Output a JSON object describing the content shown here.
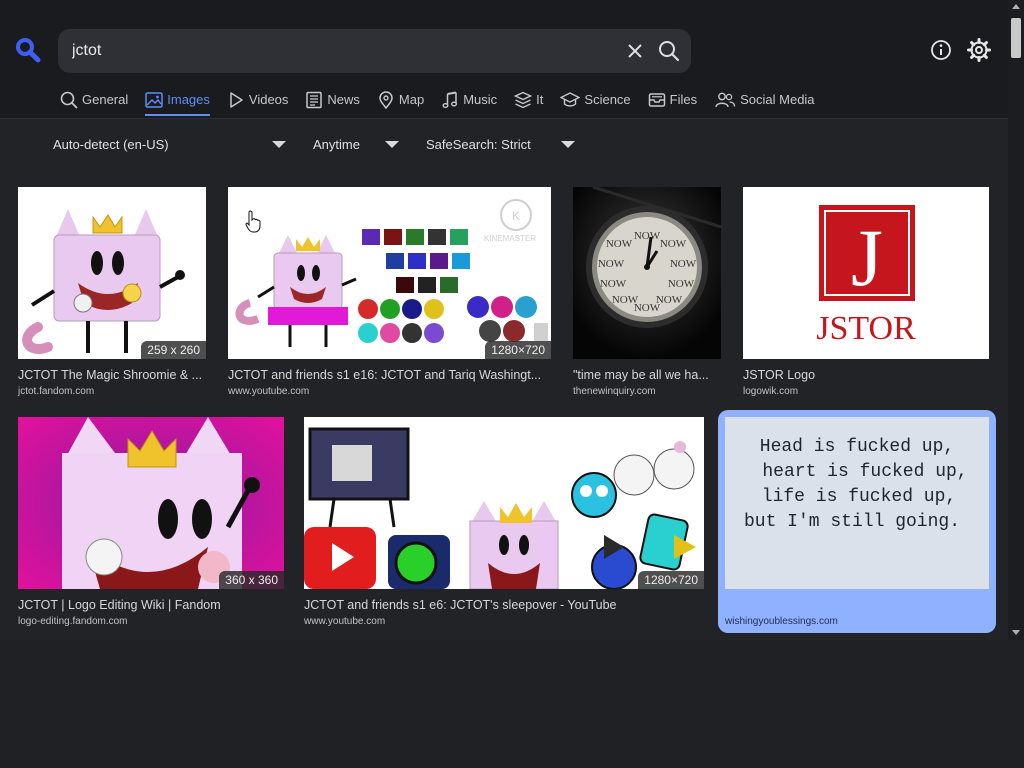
{
  "search": {
    "query": "jctot",
    "placeholder": ""
  },
  "tabs": [
    {
      "label": "General",
      "icon": "magnifier-icon",
      "active": false
    },
    {
      "label": "Images",
      "icon": "image-icon",
      "active": true
    },
    {
      "label": "Videos",
      "icon": "play-icon",
      "active": false
    },
    {
      "label": "News",
      "icon": "newspaper-icon",
      "active": false
    },
    {
      "label": "Map",
      "icon": "map-pin-icon",
      "active": false
    },
    {
      "label": "Music",
      "icon": "music-note-icon",
      "active": false
    },
    {
      "label": "It",
      "icon": "layers-icon",
      "active": false
    },
    {
      "label": "Science",
      "icon": "graduation-cap-icon",
      "active": false
    },
    {
      "label": "Files",
      "icon": "inbox-icon",
      "active": false
    },
    {
      "label": "Social Media",
      "icon": "users-icon",
      "active": false
    }
  ],
  "filters": {
    "language": "Auto-detect (en-US)",
    "time": "Anytime",
    "safesearch": "SafeSearch: Strict"
  },
  "results": [
    {
      "title": "JCTOT The Magic Shroomie & ...",
      "source": "jctot.fandom.com",
      "resolution": "259 x 260"
    },
    {
      "title": "JCTOT and friends s1 e16: JCTOT and Tariq Washingt...",
      "source": "www.youtube.com",
      "resolution": "1280×720"
    },
    {
      "title": "\"time may be all we ha...",
      "source": "thenewinquiry.com",
      "resolution": ""
    },
    {
      "title": "JSTOR Logo",
      "source": "logowik.com",
      "resolution": ""
    },
    {
      "title": "JCTOT | Logo Editing Wiki | Fandom",
      "source": "logo-editing.fandom.com",
      "resolution": "360 x 360"
    },
    {
      "title": "JCTOT and friends s1 e6: JCTOT's sleepover - YouTube",
      "source": "www.youtube.com",
      "resolution": "1280×720"
    },
    {
      "title": "",
      "source": "wishingyoublessings.com",
      "resolution": ""
    }
  ],
  "image_text": {
    "clock_word": "NOW",
    "jstor_brand": "JSTOR",
    "jstor_letter": "J",
    "watermark": "KINEMASTER",
    "quote_lines": [
      "Head is fucked up,",
      "heart is fucked up,",
      "life is fucked up,",
      "but I'm still going."
    ]
  },
  "colors": {
    "accent": "#5e8ef7",
    "selected_card": "#8fb1ff",
    "background": "#222327",
    "jstor_red": "#c4161c"
  }
}
